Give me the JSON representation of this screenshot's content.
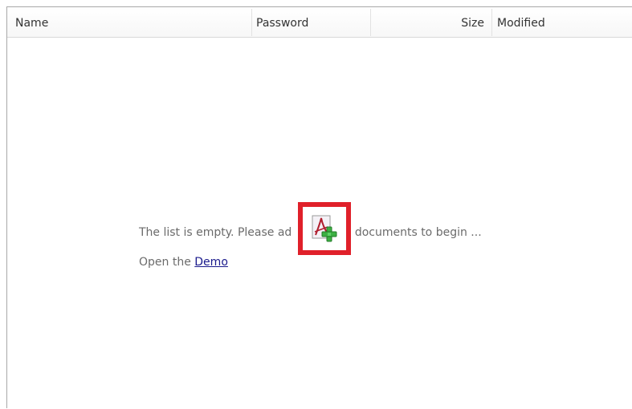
{
  "columns": {
    "name": "Name",
    "password": "Password",
    "size": "Size",
    "modified": "Modified"
  },
  "empty_state": {
    "message_before": "The list is empty. Please ad",
    "message_after": "F documents to begin ...",
    "open_prefix": "Open the ",
    "demo_link": "Demo"
  },
  "icons": {
    "add_pdf": "add-pdf-icon"
  },
  "colors": {
    "highlight_border": "#e0202a",
    "link": "#1a1a8c",
    "plus_green": "#3cb043"
  }
}
